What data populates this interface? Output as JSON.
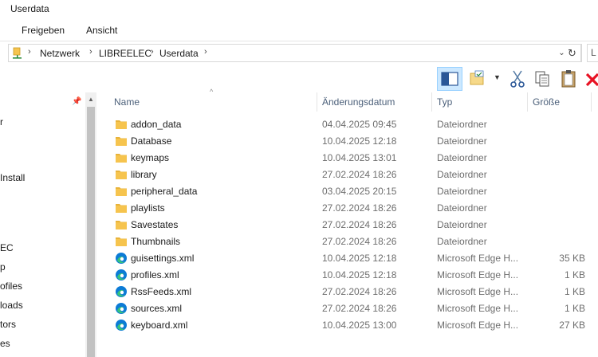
{
  "window": {
    "title": "Userdata"
  },
  "ribbon": {
    "tabs": [
      "Freigeben",
      "Ansicht"
    ]
  },
  "address": {
    "crumbs": [
      "Netzwerk",
      "LIBREELEC",
      "Userdata"
    ],
    "search_placeholder": "L"
  },
  "nav": {
    "items": [
      "r",
      "Install",
      "EC",
      "p",
      "ofiles",
      "loads",
      "tors",
      "es"
    ]
  },
  "columns": {
    "name": "Name",
    "date": "Änderungsdatum",
    "type": "Typ",
    "size": "Größe"
  },
  "files": [
    {
      "icon": "folder-icon",
      "name": "addon_data",
      "date": "04.04.2025 09:45",
      "type": "Dateiordner",
      "size": ""
    },
    {
      "icon": "folder-icon",
      "name": "Database",
      "date": "10.04.2025 12:18",
      "type": "Dateiordner",
      "size": ""
    },
    {
      "icon": "folder-icon",
      "name": "keymaps",
      "date": "10.04.2025 13:01",
      "type": "Dateiordner",
      "size": ""
    },
    {
      "icon": "folder-icon",
      "name": "library",
      "date": "27.02.2024 18:26",
      "type": "Dateiordner",
      "size": ""
    },
    {
      "icon": "folder-icon",
      "name": "peripheral_data",
      "date": "03.04.2025 20:15",
      "type": "Dateiordner",
      "size": ""
    },
    {
      "icon": "folder-icon",
      "name": "playlists",
      "date": "27.02.2024 18:26",
      "type": "Dateiordner",
      "size": ""
    },
    {
      "icon": "folder-icon",
      "name": "Savestates",
      "date": "27.02.2024 18:26",
      "type": "Dateiordner",
      "size": ""
    },
    {
      "icon": "folder-icon",
      "name": "Thumbnails",
      "date": "27.02.2024 18:26",
      "type": "Dateiordner",
      "size": ""
    },
    {
      "icon": "edge-icon",
      "name": "guisettings.xml",
      "date": "10.04.2025 12:18",
      "type": "Microsoft Edge H...",
      "size": "35 KB"
    },
    {
      "icon": "edge-icon",
      "name": "profiles.xml",
      "date": "10.04.2025 12:18",
      "type": "Microsoft Edge H...",
      "size": "1 KB"
    },
    {
      "icon": "edge-icon",
      "name": "RssFeeds.xml",
      "date": "27.02.2024 18:26",
      "type": "Microsoft Edge H...",
      "size": "1 KB"
    },
    {
      "icon": "edge-icon",
      "name": "sources.xml",
      "date": "27.02.2024 18:26",
      "type": "Microsoft Edge H...",
      "size": "1 KB"
    },
    {
      "icon": "edge-icon",
      "name": "keyboard.xml",
      "date": "10.04.2025 13:00",
      "type": "Microsoft Edge H...",
      "size": "27 KB"
    }
  ],
  "colors": {
    "folder": "#f6c44e",
    "edge_primary": "#0c7bd6",
    "edge_secondary": "#37c47b",
    "selected_btn": "#cce8ff",
    "header_text": "#4c607a",
    "delete_red": "#e81123"
  }
}
